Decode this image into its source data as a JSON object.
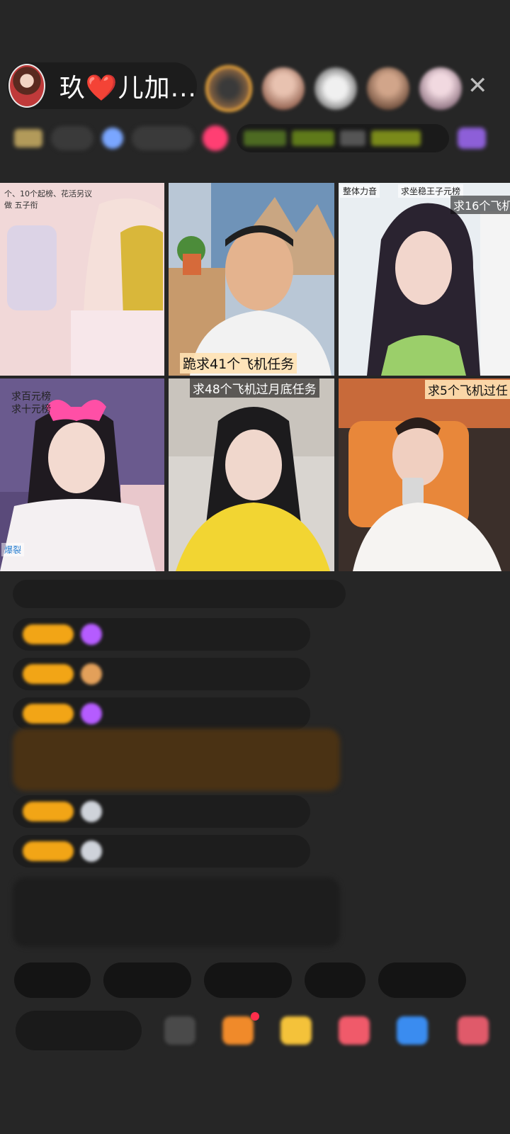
{
  "header": {
    "host_name": "玖❤️儿加...",
    "close_label": "✕",
    "viewer_colors": [
      "#8a6440",
      "#c99a84",
      "#d8d8d8",
      "#9c7a60",
      "#d2b6c2"
    ]
  },
  "grid": {
    "tiles": [
      {
        "caption_lines": [
          "个、10个起榜、花活另议",
          "做 五子衔"
        ]
      },
      {
        "caption": "跪求41个飞机任务"
      },
      {
        "caption_top_left": "整体力音",
        "caption_top_mid": "求坐稳王子元榜",
        "caption": "求16个飞机"
      },
      {
        "caption_lines": [
          "求百元榜",
          "求十元榜"
        ],
        "bottom_left": "爆裂"
      },
      {
        "caption": "求48个飞机过月底任务"
      },
      {
        "caption": "求5个飞机过任"
      }
    ]
  },
  "bottom": {
    "notification_dot_color": "#ff2e4b"
  }
}
